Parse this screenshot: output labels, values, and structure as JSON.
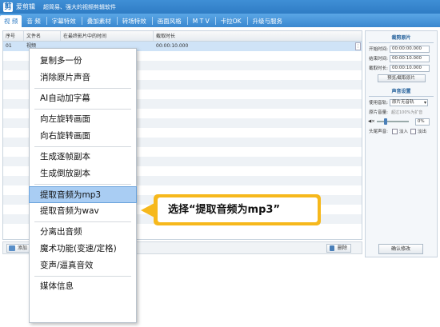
{
  "titlebar": {
    "app_name": "爱剪辑",
    "slogan": "超简易、强大的视频剪辑软件",
    "logo_glyph": "剪"
  },
  "tabs": [
    {
      "label": "视 频",
      "active": true
    },
    {
      "label": "音 频"
    },
    {
      "label": "字幕特效"
    },
    {
      "label": "叠加素材"
    },
    {
      "label": "转场特效"
    },
    {
      "label": "画面风格"
    },
    {
      "label": "M T V"
    },
    {
      "label": "卡拉OK"
    },
    {
      "label": "升级与服务"
    }
  ],
  "table": {
    "columns": [
      "序号",
      "文件名",
      "在最终影片中的时间",
      "截取时长"
    ],
    "rows": [
      {
        "index": "01",
        "name": "视频",
        "time": "",
        "duration": "00:00:10.000"
      }
    ],
    "scroll_glyph": "⋮"
  },
  "bottom": {
    "add_label": "添加",
    "delete_label": "删除"
  },
  "panel": {
    "clip_title": "裁剪原片",
    "start_label": "开始时间:",
    "start_value": "00:00:00.000",
    "end_label": "结束时间:",
    "end_value": "00:00:10.000",
    "dur_label": "截取时长:",
    "dur_value": "00:00:10.000",
    "preview_label": "预览/截取原片",
    "audio_title": "声音设置",
    "track_label": "使用音轨:",
    "track_value": "原片无音轨",
    "volume_label": "原片音量:",
    "volume_hint": "超过100%为扩音",
    "volume_icon": "◀×",
    "volume_value": "0%",
    "fade_label": "头尾声音:",
    "fade_in": "淡入",
    "fade_out": "淡出",
    "confirm_label": "确认修改"
  },
  "context_menu": {
    "groups": [
      [
        "复制多一份",
        "消除原片声音"
      ],
      [
        "AI自动加字幕"
      ],
      [
        "向左旋转画面",
        "向右旋转画面"
      ],
      [
        "生成逐帧副本",
        "生成倒放副本"
      ],
      [
        "提取音频为mp3",
        "提取音频为wav"
      ],
      [
        "分离出音频",
        "魔术功能(变速/定格)",
        "变声/逼真音效"
      ],
      [
        "媒体信息"
      ]
    ],
    "highlighted": "提取音频为mp3"
  },
  "callout": {
    "text": "选择“提取音频为mp3”",
    "color": "#f6b81c"
  },
  "colors": {
    "title_bar": "#2f7cc4",
    "tab_bar": "#3a88cf",
    "highlight": "#a9cdf3",
    "selected_row": "#cfe3f7"
  }
}
